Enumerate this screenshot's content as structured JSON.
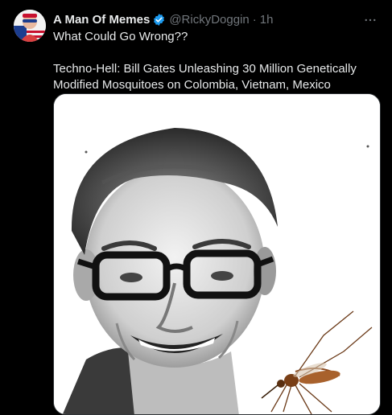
{
  "tweet": {
    "display_name": "A Man Of Memes",
    "handle": "@RickyDoggin",
    "separator": "·",
    "time": "1h",
    "more_label": "···",
    "text_line1": "What Could Go Wrong??",
    "text_line2": "Techno-Hell: Bill Gates Unleashing 30 Million Genetically Modified Mosquitoes on Colombia, Vietnam, Mexico",
    "media": {
      "icon": "photo-portrait-with-mosquito"
    }
  },
  "colors": {
    "background": "#000000",
    "text_primary": "#e7e9ea",
    "text_secondary": "#71767b",
    "verified_blue": "#1d9bf0"
  },
  "icons": {
    "verified": "verified-badge-icon",
    "more": "more-options-icon",
    "avatar": "user-avatar-flag-portrait"
  }
}
